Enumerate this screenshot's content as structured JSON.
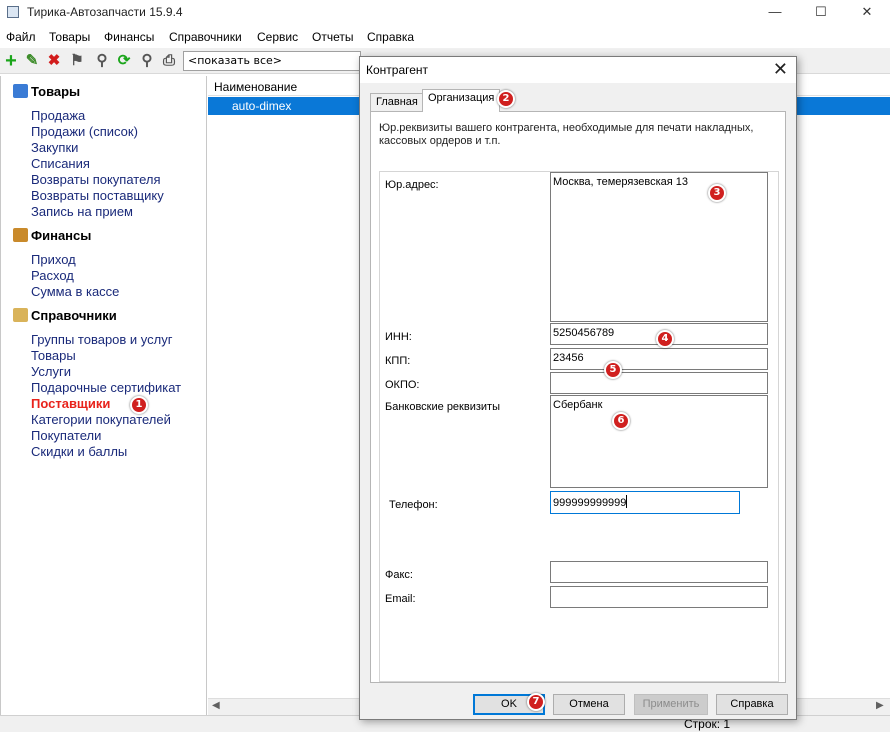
{
  "app": {
    "title": "Тирика-Автозапчасти 15.9.4",
    "minimize": "—",
    "maximize": "☐",
    "close": "✕"
  },
  "menu": [
    "Файл",
    "Товары",
    "Финансы",
    "Справочники",
    "Сервис",
    "Отчеты",
    "Справка"
  ],
  "toolbar": {
    "filter_value": "<показать все>"
  },
  "sidebar": {
    "sections": [
      {
        "title": "Товары",
        "items": [
          "Продажа",
          "Продажи (список)",
          "Закупки",
          "Списания",
          "Возвраты покупателя",
          "Возвраты поставщику",
          "Запись на прием"
        ]
      },
      {
        "title": "Финансы",
        "items": [
          "Приход",
          "Расход",
          "Сумма в кассе"
        ]
      },
      {
        "title": "Справочники",
        "items": [
          "Группы товаров и услуг",
          "Товары",
          "Услуги",
          "Подарочные сертификат",
          "Поставщики",
          "Категории покупателей",
          "Покупатели",
          "Скидки и баллы"
        ]
      }
    ],
    "active_item": "Поставщики"
  },
  "grid": {
    "column_header": "Наименование",
    "rows": [
      "auto-dimex"
    ]
  },
  "status": {
    "rows_label": "Строк: 1"
  },
  "dialog": {
    "title": "Контрагент",
    "close": "✕",
    "tabs": [
      "Главная",
      "Организация"
    ],
    "active_tab": "Организация",
    "description": "Юр.реквизиты вашего контрагента, необходимые для печати накладных, кассовых ордеров и т.п.",
    "fields": {
      "legal_address": {
        "label": "Юр.адрес:",
        "value": "Москва, темерязевская 13"
      },
      "inn": {
        "label": "ИНН:",
        "value": "5250456789"
      },
      "kpp": {
        "label": "КПП:",
        "value": "23456"
      },
      "okpo": {
        "label": "ОКПО:",
        "value": ""
      },
      "bank": {
        "label": "Банковские реквизиты",
        "value": "Сбербанк"
      },
      "phone": {
        "label": "Телефон:",
        "value": "999999999999"
      },
      "fax": {
        "label": "Факс:",
        "value": ""
      },
      "email": {
        "label": "Email:",
        "value": ""
      }
    },
    "buttons": {
      "ok": "OK",
      "cancel": "Отмена",
      "apply": "Применить",
      "help": "Справка"
    }
  },
  "badges": [
    "1",
    "2",
    "3",
    "4",
    "5",
    "6",
    "7"
  ],
  "colors": {
    "accent": "#0078d7",
    "selection": "#0a78d7",
    "badge": "#d0201f",
    "active_nav": "#e8231c",
    "nav": "#1a2a7a"
  }
}
